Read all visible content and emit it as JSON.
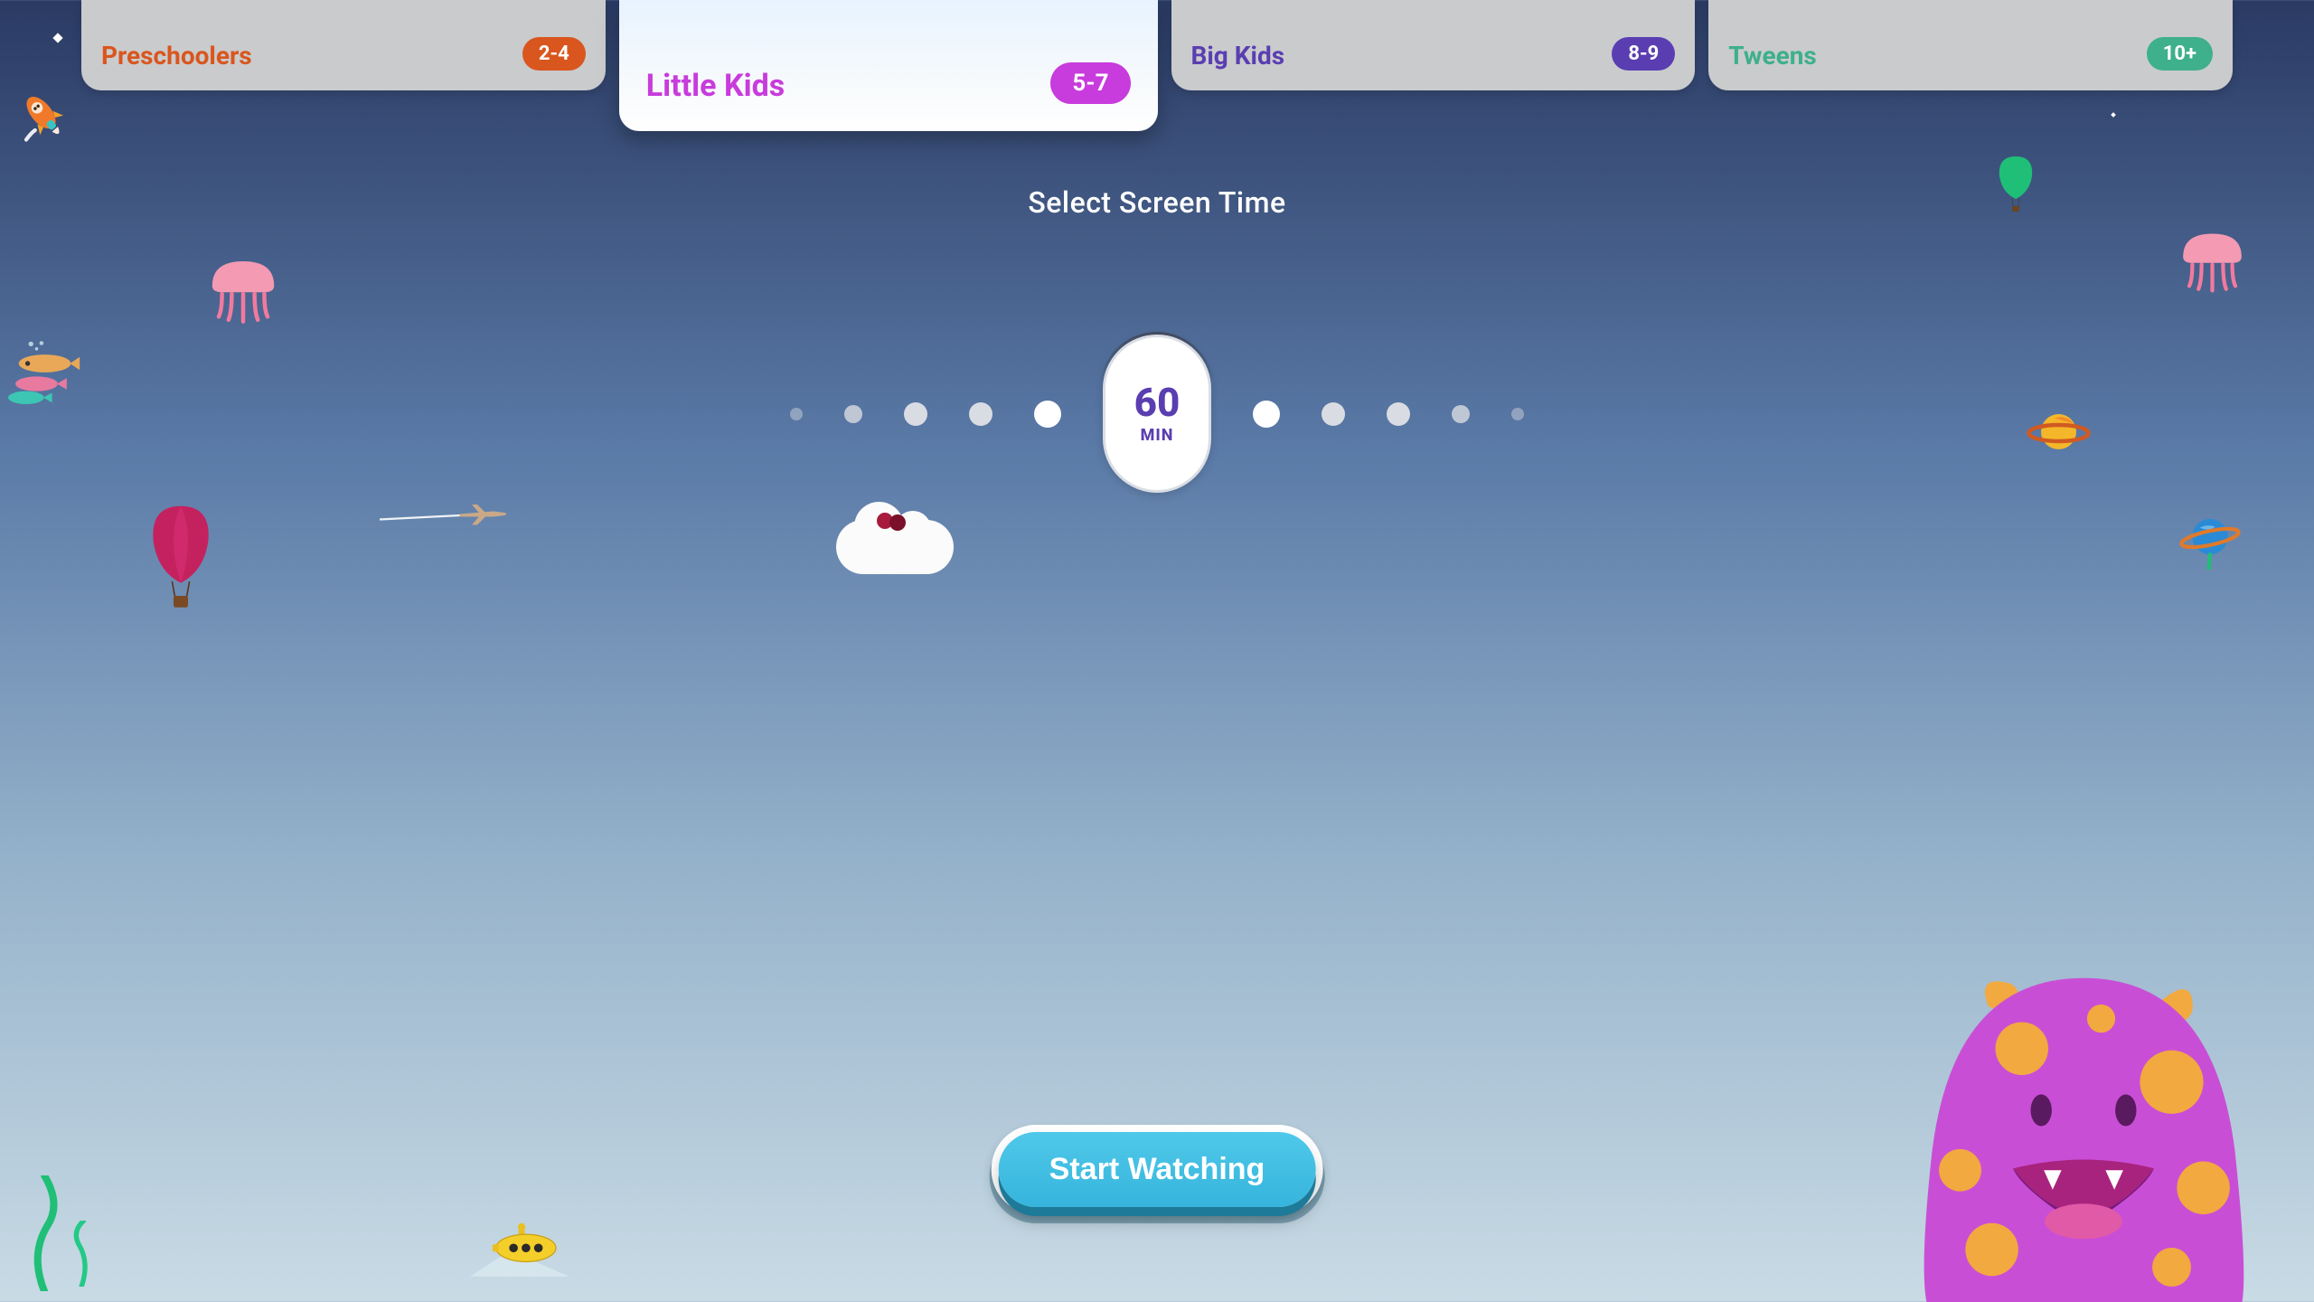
{
  "ageCategories": [
    {
      "key": "preschool",
      "label": "Preschoolers",
      "range": "2-4",
      "active": false
    },
    {
      "key": "littlekids",
      "label": "Little Kids",
      "range": "5-7",
      "active": true
    },
    {
      "key": "bigkids",
      "label": "Big Kids",
      "range": "8-9",
      "active": false
    },
    {
      "key": "tweens",
      "label": "Tweens",
      "range": "10+",
      "active": false
    }
  ],
  "section": {
    "title": "Select Screen Time"
  },
  "screenTime": {
    "value": "60",
    "unit": "MIN"
  },
  "cta": {
    "start": "Start Watching"
  },
  "colors": {
    "preschool": "#d9561e",
    "littlekids": "#c83bdc",
    "bigkids": "#5a3eb1",
    "tweens": "#3eb08b",
    "accentPurple": "#5a3eb1",
    "ctaBg": "#3cbde2"
  }
}
